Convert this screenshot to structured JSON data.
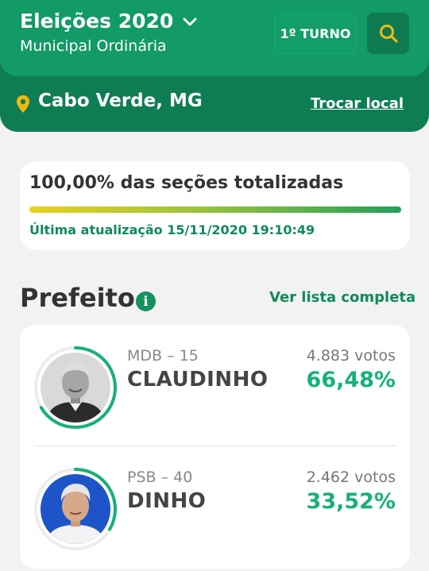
{
  "header": {
    "title": "Eleições 2020",
    "subtitle": "Municipal Ordinária",
    "turno_label": "1º TURNO",
    "location": "Cabo Verde, MG",
    "change_location_label": "Trocar local"
  },
  "colors": {
    "header_green": "#129a67",
    "header_dark_green": "#0f7d54",
    "accent_yellow": "#f2b90f",
    "percent_green": "#17b07b"
  },
  "totals": {
    "sections_label": "100,00% das seções totalizadas",
    "progress_percent": 100,
    "last_update": "Última atualização 15/11/2020 19:10:49"
  },
  "office": {
    "title": "Prefeito",
    "info_icon": "i",
    "see_full_list_label": "Ver lista completa"
  },
  "candidates": [
    {
      "party": "MDB – 15",
      "name": "CLAUDINHO",
      "votes": "4.883 votos",
      "percent": "66,48%",
      "percent_value": 66.48
    },
    {
      "party": "PSB – 40",
      "name": "DINHO",
      "votes": "2.462 votos",
      "percent": "33,52%",
      "percent_value": 33.52
    }
  ]
}
